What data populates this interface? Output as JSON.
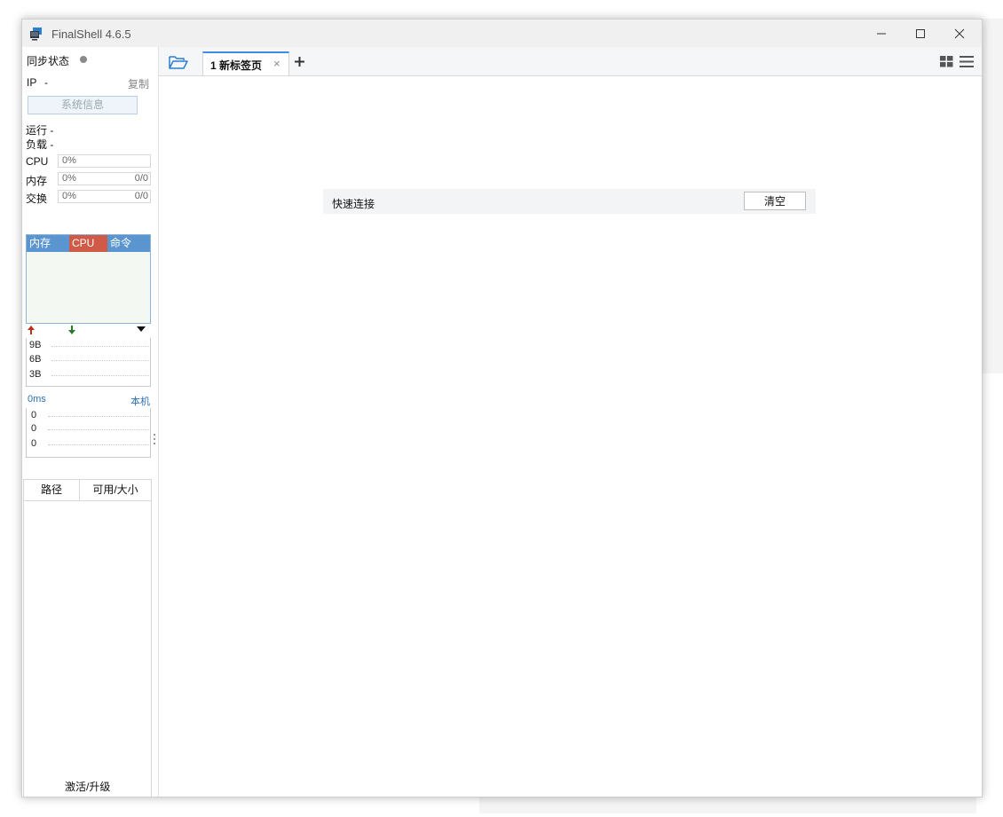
{
  "window": {
    "title": "FinalShell 4.6.5"
  },
  "sidebar": {
    "sync_label": "同步状态",
    "ip_label": "IP",
    "ip_value": "-",
    "copy_label": "复制",
    "sysinfo_button": "系统信息",
    "uptime_label": "运行 -",
    "load_label": "负载 -",
    "cpu": {
      "label": "CPU",
      "percent": "0%"
    },
    "mem": {
      "label": "内存",
      "percent": "0%",
      "amount": "0/0"
    },
    "swap": {
      "label": "交换",
      "percent": "0%",
      "amount": "0/0"
    },
    "process_tabs": [
      "内存",
      "CPU",
      "命令"
    ],
    "network": {
      "y_labels": [
        "9B",
        "6B",
        "3B"
      ]
    },
    "latency": {
      "value": "0ms",
      "target": "本机",
      "y_labels": [
        "0",
        "0",
        "0"
      ]
    },
    "fs_columns": [
      "路径",
      "可用/大小"
    ],
    "activate_label": "激活/升级"
  },
  "tabs": [
    {
      "label": "1 新标签页"
    }
  ],
  "quick_connect": {
    "label": "快速连接",
    "clear_button": "清空"
  },
  "colors": {
    "accent": "#3b8de0",
    "process_mem": "#5b95cf",
    "process_cpu": "#cf5b47",
    "upload_arrow": "#b5331c",
    "download_arrow": "#2f7a2a"
  }
}
